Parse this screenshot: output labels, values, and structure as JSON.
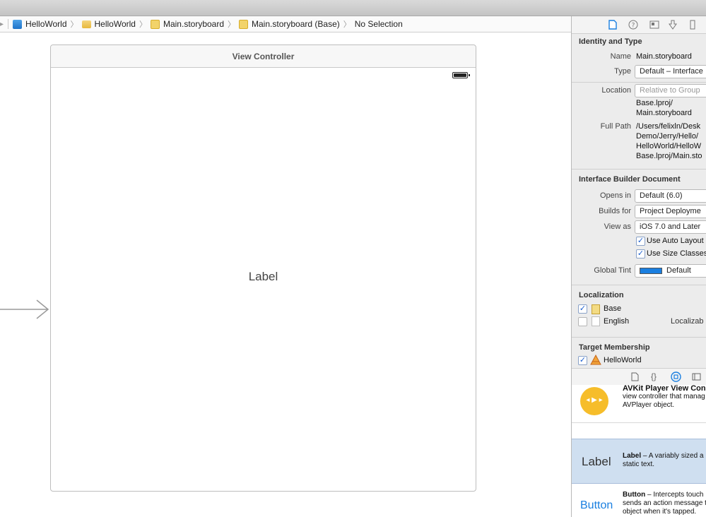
{
  "jumpbar": {
    "nav_glyph": "▸",
    "crumbs": [
      {
        "label": "HelloWorld",
        "icon": "project-icon"
      },
      {
        "label": "HelloWorld",
        "icon": "folder-icon"
      },
      {
        "label": "Main.storyboard",
        "icon": "storyboard-file-icon"
      },
      {
        "label": "Main.storyboard (Base)",
        "icon": "storyboard-file-icon"
      },
      {
        "label": "No Selection",
        "icon": ""
      }
    ],
    "separator": "〉"
  },
  "canvas": {
    "scene_title": "View Controller",
    "label_text": "Label"
  },
  "inspector": {
    "identity": {
      "title": "Identity and Type",
      "name_label": "Name",
      "name_value": "Main.storyboard",
      "type_label": "Type",
      "type_value": "Default – Interface",
      "location_label": "Location",
      "location_value": "Relative to Group",
      "location_path_1": "Base.lproj/",
      "location_path_2": "Main.storyboard",
      "fullpath_label": "Full Path",
      "fullpath_1": "/Users/felixln/Desk",
      "fullpath_2": "Demo/Jerry/Hello/",
      "fullpath_3": "HelloWorld/HelloW",
      "fullpath_4": "Base.lproj/Main.sto"
    },
    "ibdoc": {
      "title": "Interface Builder Document",
      "opens_label": "Opens in",
      "opens_value": "Default (6.0)",
      "builds_label": "Builds for",
      "builds_value": "Project Deployme",
      "viewas_label": "View as",
      "viewas_value": "iOS 7.0 and Later",
      "autolayout": "Use Auto Layout",
      "sizeclasses": "Use Size Classes",
      "tint_label": "Global Tint",
      "tint_value": "Default",
      "tint_color": "#1a7fe0"
    },
    "localization": {
      "title": "Localization",
      "items": [
        {
          "name": "Base",
          "checked": true,
          "extra": ""
        },
        {
          "name": "English",
          "checked": false,
          "extra": "Localizab"
        }
      ]
    },
    "membership": {
      "title": "Target Membership",
      "target": "HelloWorld"
    },
    "library": {
      "items": [
        {
          "name": "AVKit Player View Con",
          "desc_1": "view controller that manag",
          "desc_2": "AVPlayer object."
        },
        {
          "title": "Label",
          "name": "Label",
          "desc_1": " – A variably sized a",
          "desc_2": "static text."
        },
        {
          "title": "Button",
          "name": "Button",
          "desc_1": " – Intercepts touch",
          "desc_2": "sends an action message t",
          "desc_3": "object when it's tapped."
        }
      ]
    }
  }
}
